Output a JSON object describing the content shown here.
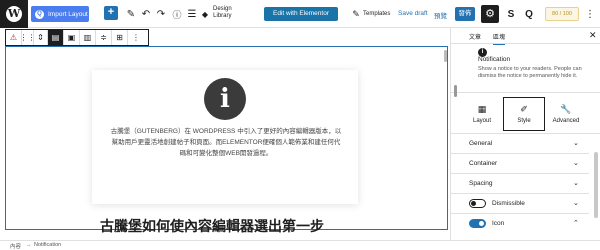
{
  "toolbar": {
    "import_label": "Import Layout",
    "design_library_line1": "Design",
    "design_library_line2": "Library",
    "elementor_label": "Edit with Elementor",
    "templates_label": "Templates",
    "save_draft": "Save draft",
    "preview": "預覽",
    "publish": "發佈",
    "score": "80 / 100",
    "icons": [
      "wordpress-logo",
      "add",
      "pencil",
      "undo",
      "redo",
      "info",
      "list-view",
      "templates",
      "settings",
      "strikethrough-s",
      "circle-q"
    ]
  },
  "canvas": {
    "notice_text": "古騰堡（GUTENBERG）在 WORDPRESS 中引入了更好的內容編輯器版本，以幫助用戶更靈活地創建帖子和頁面。而ELEMENTOR便確個人範佈業和建任何代碼和可變化整個WEB開發過程。",
    "heading": "古騰堡如何使內容編輯器選出第一步"
  },
  "sidebar": {
    "tabs": [
      "文章",
      "區塊"
    ],
    "block_title": "Notification",
    "block_desc": "Show a notice to your readers. People can dismiss the notice to permanently hide it.",
    "style_tabs": [
      "Layout",
      "Style",
      "Advanced"
    ],
    "panels": [
      "General",
      "Container",
      "Spacing"
    ],
    "toggles": [
      "Dismissible",
      "Icon"
    ]
  },
  "breadcrumb": {
    "root": "內容",
    "separator": "→",
    "current": "Notification"
  }
}
